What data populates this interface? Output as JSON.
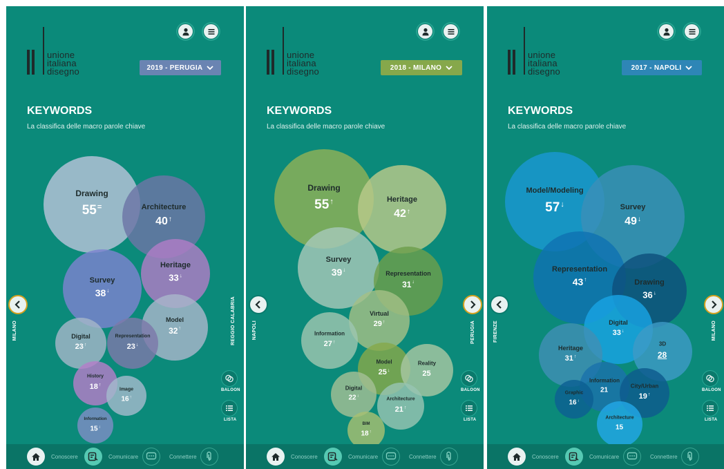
{
  "brand": {
    "line1": "unione",
    "line2": "italiana",
    "line3": "disegno"
  },
  "section": {
    "title": "KEYWORDS",
    "subtitle": "La classifica delle macro parole chiave"
  },
  "icons": {
    "user": "user-icon",
    "menu": "menu-icon",
    "chevron": "chevron-down-icon",
    "home": "home-icon",
    "conoscere": "document-icon",
    "comunicare": "chat-icon",
    "connettere": "link-icon",
    "baloon": "baloon-icon",
    "lista": "list-icon"
  },
  "tools": {
    "baloon": "BALOON",
    "lista": "LISTA"
  },
  "bottom_nav": {
    "conoscere": "Conoscere",
    "comunicare": "Comunicare",
    "connettere": "Connettere"
  },
  "panels": [
    {
      "year_label": "2019 - PERUGIA",
      "select_color": "#6a84b2",
      "prev_city": "MILANO",
      "next_city": "REGGIO CALABRIA",
      "bubbles": [
        {
          "label": "Drawing",
          "value": "55",
          "trend": "=",
          "color": "#b7c3d9"
        },
        {
          "label": "Architecture",
          "value": "40",
          "trend": "↑",
          "color": "#6c75a6"
        },
        {
          "label": "Heritage",
          "value": "33",
          "trend": "↓",
          "color": "#b07cc6"
        },
        {
          "label": "Survey",
          "value": "38",
          "trend": "↓",
          "color": "#7d82cf"
        },
        {
          "label": "Model",
          "value": "32",
          "trend": "↑",
          "color": "#a8b6ca"
        },
        {
          "label": "Digital",
          "value": "23",
          "trend": "↑",
          "color": "#a3b6c8"
        },
        {
          "label": "Representation",
          "value": "23",
          "trend": "↓",
          "color": "#7d79a9"
        },
        {
          "label": "History",
          "value": "18",
          "trend": "↑",
          "color": "#b57ec8"
        },
        {
          "label": "Image",
          "value": "16",
          "trend": "↑",
          "color": "#a3b9cc"
        },
        {
          "label": "Information",
          "value": "15",
          "trend": "↓",
          "color": "#7e8ec5"
        }
      ]
    },
    {
      "year_label": "2018 - MILANO",
      "select_color": "#86a84b",
      "prev_city": "NAPOLI",
      "next_city": "PERUGIA",
      "bubbles": [
        {
          "label": "Drawing",
          "value": "55",
          "trend": "↑",
          "color": "#8fb157"
        },
        {
          "label": "Heritage",
          "value": "42",
          "trend": "↑",
          "color": "#b9c98a"
        },
        {
          "label": "Survey",
          "value": "39",
          "trend": "↓",
          "color": "#a6c8b8"
        },
        {
          "label": "Representation",
          "value": "31",
          "trend": "↓",
          "color": "#6d9f4c"
        },
        {
          "label": "Virtual",
          "value": "29",
          "trend": "↑",
          "color": "#a3bf86"
        },
        {
          "label": "Information",
          "value": "27",
          "trend": "↑",
          "color": "#9ec6b0"
        },
        {
          "label": "Model",
          "value": "25",
          "trend": "↓",
          "color": "#86a84b"
        },
        {
          "label": "Reality",
          "value": "25",
          "trend": "",
          "color": "#a7c7a2"
        },
        {
          "label": "Digital",
          "value": "22",
          "trend": "↓",
          "color": "#a3c095"
        },
        {
          "label": "Architecture",
          "value": "21",
          "trend": "↑",
          "color": "#97c5b2"
        },
        {
          "label": "BIM",
          "value": "18",
          "trend": "↑",
          "color": "#a7c072"
        }
      ]
    },
    {
      "year_label": "2017 - NAPOLI",
      "select_color": "#2e86b6",
      "prev_city": "FIRENZE",
      "next_city": "MILANO",
      "bubbles": [
        {
          "label": "Model/Modeling",
          "value": "57",
          "trend": "↓",
          "color": "#1a97d3"
        },
        {
          "label": "Survey",
          "value": "49",
          "trend": "↓",
          "color": "#3a8fb8"
        },
        {
          "label": "Representation",
          "value": "43",
          "trend": "↑",
          "color": "#0f72b2"
        },
        {
          "label": "Drawing",
          "value": "36",
          "trend": "↓",
          "color": "#0d4f7c"
        },
        {
          "label": "Digital",
          "value": "33",
          "trend": "↓",
          "color": "#19a4e4"
        },
        {
          "label": "3D",
          "value": "28",
          "trend": "",
          "color": "#3d9ac6"
        },
        {
          "label": "Heritage",
          "value": "31",
          "trend": "↑",
          "color": "#3f8fb5"
        },
        {
          "label": "Information",
          "value": "21",
          "trend": "",
          "color": "#1b72ab"
        },
        {
          "label": "City/Urban",
          "value": "19",
          "trend": "↑",
          "color": "#0e5a8d"
        },
        {
          "label": "Graphic",
          "value": "16",
          "trend": "↓",
          "color": "#0c5f93"
        },
        {
          "label": "Architecture",
          "value": "15",
          "trend": "",
          "color": "#22a7e6"
        }
      ]
    }
  ]
}
